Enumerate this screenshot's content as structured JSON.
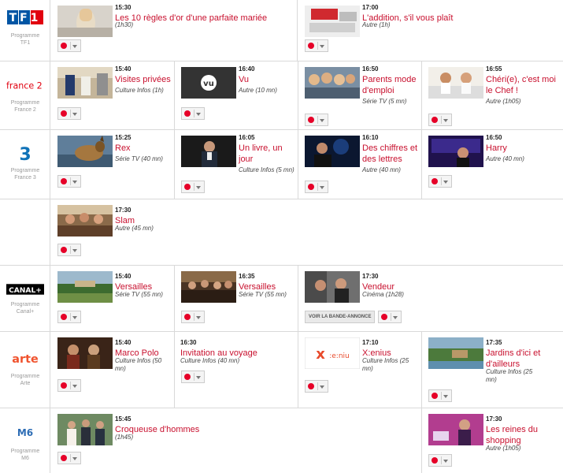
{
  "colors": {
    "accent": "#c8102e",
    "record": "#e60028"
  },
  "rows": [
    {
      "id": "tf1",
      "logo": "TF1",
      "label_line1": "Programme",
      "label_line2": "TF1",
      "programs": [
        {
          "time": "15:30",
          "title": "Les 10 règles d'or d'une parfaite mariée",
          "meta": "(1h30)"
        },
        {
          "time": "17:00",
          "title": "L'addition, s'il vous plaît",
          "meta": "Autre (1h)"
        }
      ]
    },
    {
      "id": "france2",
      "logo": "france 2",
      "label_line1": "Programme",
      "label_line2": "France 2",
      "programs": [
        {
          "time": "15:40",
          "title": "Visites privées",
          "meta": "Culture Infos (1h)"
        },
        {
          "time": "16:40",
          "title": "Vu",
          "meta": "Autre (10 mn)"
        },
        {
          "time": "16:50",
          "title": "Parents mode d'emploi",
          "meta": "Série TV (5 mn)"
        },
        {
          "time": "16:55",
          "title": "Chéri(e), c'est moi le Chef !",
          "meta": "Autre (1h05)"
        }
      ]
    },
    {
      "id": "france3",
      "logo": "3",
      "label_line1": "Programme",
      "label_line2": "France 3",
      "programs": [
        {
          "time": "15:25",
          "title": "Rex",
          "meta": "Série TV (40 mn)"
        },
        {
          "time": "16:05",
          "title": "Un livre, un jour",
          "meta": "Culture Infos (5 mn)"
        },
        {
          "time": "16:10",
          "title": "Des chiffres et des lettres",
          "meta": "Autre (40 mn)"
        },
        {
          "time": "16:50",
          "title": "Harry",
          "meta": "Autre (40 mn)"
        }
      ]
    },
    {
      "id": "france3b",
      "logo": "",
      "label_line1": "",
      "label_line2": "",
      "programs": [
        {
          "time": "17:30",
          "title": "Slam",
          "meta": "Autre (45 mn)"
        }
      ]
    },
    {
      "id": "canal",
      "logo": "CANAL+",
      "label_line1": "Programme",
      "label_line2": "Canal+",
      "programs": [
        {
          "time": "15:40",
          "title": "Versailles",
          "meta": "Série TV (55 mn)"
        },
        {
          "time": "16:35",
          "title": "Versailles",
          "meta": "Série TV (55 mn)"
        },
        {
          "time": "17:30",
          "title": "Vendeur",
          "meta": "Cinéma (1h28)",
          "trailer": "VOIR LA BANDE-ANNONCE"
        }
      ]
    },
    {
      "id": "arte",
      "logo": "arte",
      "label_line1": "Programme",
      "label_line2": "Arte",
      "programs": [
        {
          "time": "15:40",
          "title": "Marco Polo",
          "meta": "Culture Infos (50 mn)"
        },
        {
          "time": "16:30",
          "title": "Invitation au voyage",
          "meta": "Culture Infos (40 mn)"
        },
        {
          "time": "17:10",
          "title": "X:enius",
          "meta": "Culture Infos (25 mn)"
        },
        {
          "time": "17:35",
          "title": "Jardins d'ici et d'ailleurs",
          "meta": "Culture Infos (25 mn)"
        }
      ]
    },
    {
      "id": "m6",
      "logo": "M6",
      "label_line1": "Programme",
      "label_line2": "M6",
      "programs": [
        {
          "time": "15:45",
          "title": "Croqueuse d'hommes",
          "meta": "(1h45)"
        },
        {
          "time": "17:30",
          "title": "Les reines du shopping",
          "meta": "Autre (1h05)"
        }
      ]
    }
  ]
}
